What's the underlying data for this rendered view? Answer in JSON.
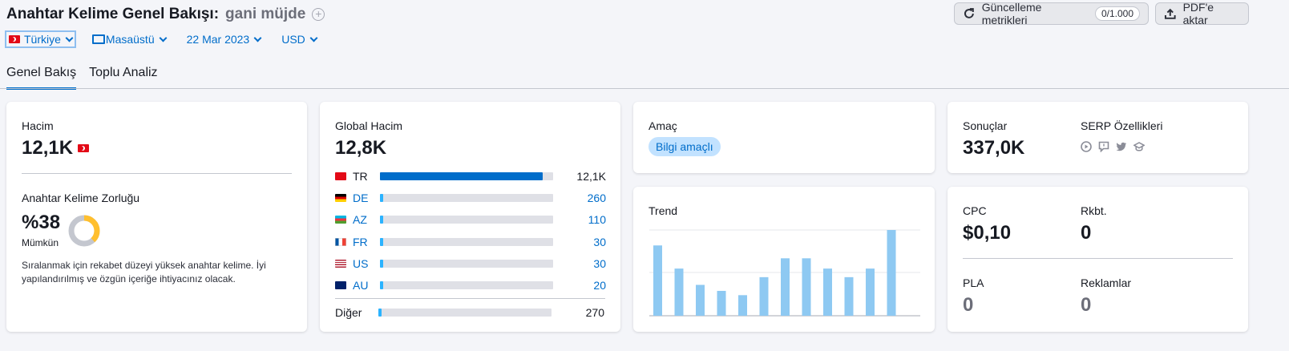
{
  "header": {
    "title": "Anahtar Kelime Genel Bakışı:",
    "keyword": "gani müjde",
    "update_metrics_label": "Güncelleme metrikleri",
    "update_quota": "0/1.000",
    "export_pdf_label": "PDF'e aktar"
  },
  "filters": {
    "country": "Türkiye",
    "device": "Masaüstü",
    "date": "22 Mar 2023",
    "currency": "USD"
  },
  "tabs": [
    {
      "label": "Genel Bakış",
      "active": true
    },
    {
      "label": "Toplu Analiz",
      "active": false
    }
  ],
  "volume": {
    "label": "Hacim",
    "value": "12,1K"
  },
  "difficulty": {
    "label": "Anahtar Kelime Zorluğu",
    "value": "%38",
    "level": "Mümkün",
    "percent": 38,
    "description": "Sıralanmak için rekabet düzeyi yüksek anahtar kelime. İyi yapılandırılmış ve özgün içeriğe ihtiyacınız olacak."
  },
  "global_volume": {
    "label": "Global Hacim",
    "value": "12,8K",
    "countries": [
      {
        "code": "TR",
        "value": "12,1K",
        "share": 0.94
      },
      {
        "code": "DE",
        "value": "260",
        "share": 0.02
      },
      {
        "code": "AZ",
        "value": "110",
        "share": 0.02
      },
      {
        "code": "FR",
        "value": "30",
        "share": 0.02
      },
      {
        "code": "US",
        "value": "30",
        "share": 0.02
      },
      {
        "code": "AU",
        "value": "20",
        "share": 0.02
      }
    ],
    "other_label": "Diğer",
    "other_value": "270",
    "other_share": 0.02
  },
  "intent": {
    "label": "Amaç",
    "value": "Bilgi amaçlı"
  },
  "trend": {
    "label": "Trend",
    "values": [
      0.82,
      0.55,
      0.36,
      0.29,
      0.24,
      0.45,
      0.67,
      0.67,
      0.55,
      0.45,
      0.55,
      1.0
    ]
  },
  "results": {
    "label": "Sonuçlar",
    "value": "337,0K",
    "serp_label": "SERP Özellikleri",
    "serp_icons": [
      "video-icon",
      "faq-icon",
      "twitter-icon",
      "education-icon"
    ]
  },
  "cpc": {
    "label": "CPC",
    "value": "$0,10",
    "competition_label": "Rkbt.",
    "competition_value": "0",
    "pla_label": "PLA",
    "pla_value": "0",
    "ads_label": "Reklamlar",
    "ads_value": "0"
  },
  "colors": {
    "accent": "#006dca",
    "trend_bar": "#8ec9f2",
    "difficulty_ring": "#ffbf2e"
  }
}
